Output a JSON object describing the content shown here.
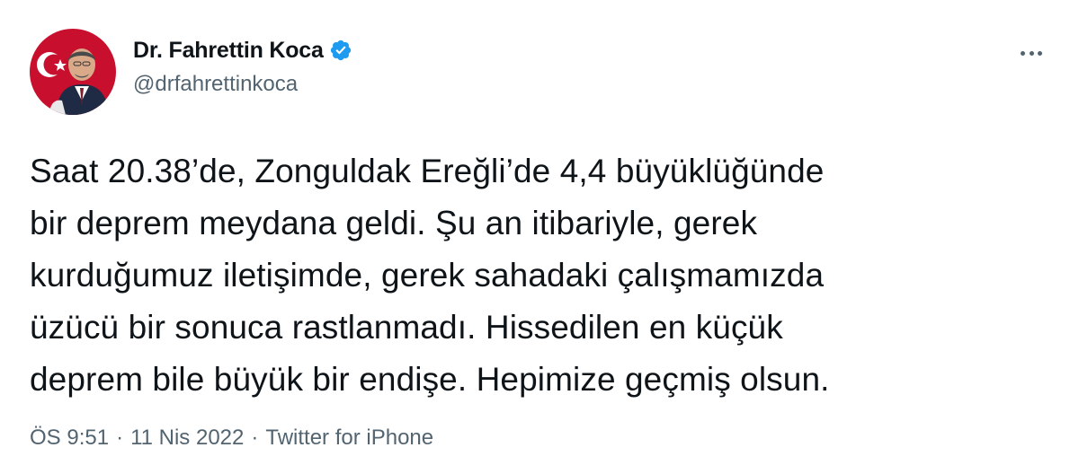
{
  "author": {
    "display_name": "Dr. Fahrettin Koca",
    "handle": "@drfahrettinkoca",
    "verified": true
  },
  "tweet": {
    "text": "Saat 20.38’de, Zonguldak Ereğli’de 4,4 büyüklüğünde\nbir deprem meydana geldi. Şu an itibariyle, gerek\nkurduğumuz iletişimde, gerek sahadaki çalışmamızda\nüzücü bir sonuca rastlanmadı. Hissedilen en küçük\ndeprem bile büyük bir endişe. Hepimize geçmiş olsun."
  },
  "meta": {
    "time": "ÖS 9:51",
    "separator": "·",
    "date": "11 Nis 2022",
    "source": "Twitter for iPhone"
  },
  "colors": {
    "text": "#0f1419",
    "secondary": "#536471",
    "verified_blue": "#1d9bf0"
  },
  "icons": {
    "verified": "verified-badge-icon",
    "more": "more-options-icon"
  }
}
